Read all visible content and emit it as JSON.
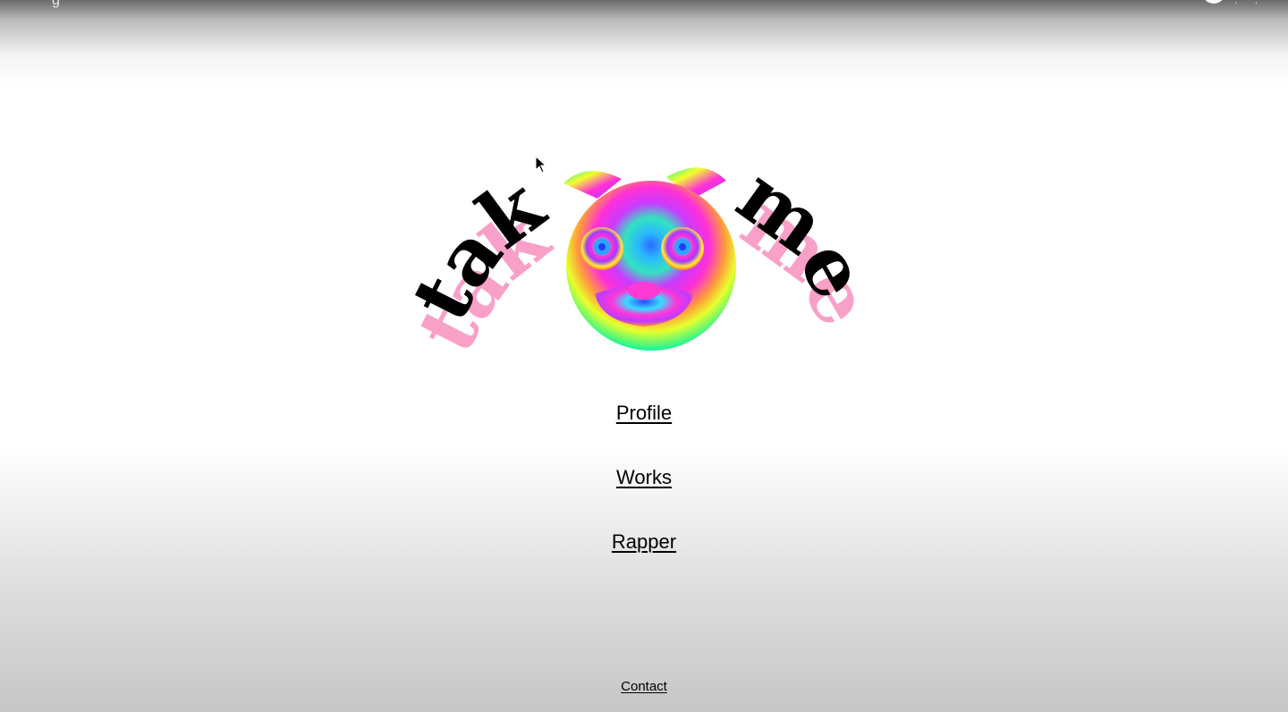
{
  "overlay": {
    "title_fragment": "g",
    "dots": "⋮ ⋮"
  },
  "logo": {
    "text_left": "tak",
    "text_right": "me",
    "text_color": "#000000",
    "shadow_color": "#f9a0c8",
    "mascot_icon": "rainbow-cat-face-icon"
  },
  "nav": {
    "profile_label": "Profile",
    "works_label": "Works",
    "rapper_label": "Rapper"
  },
  "footer": {
    "contact_label": "Contact"
  },
  "cursor_icon": "mouse-pointer-icon"
}
